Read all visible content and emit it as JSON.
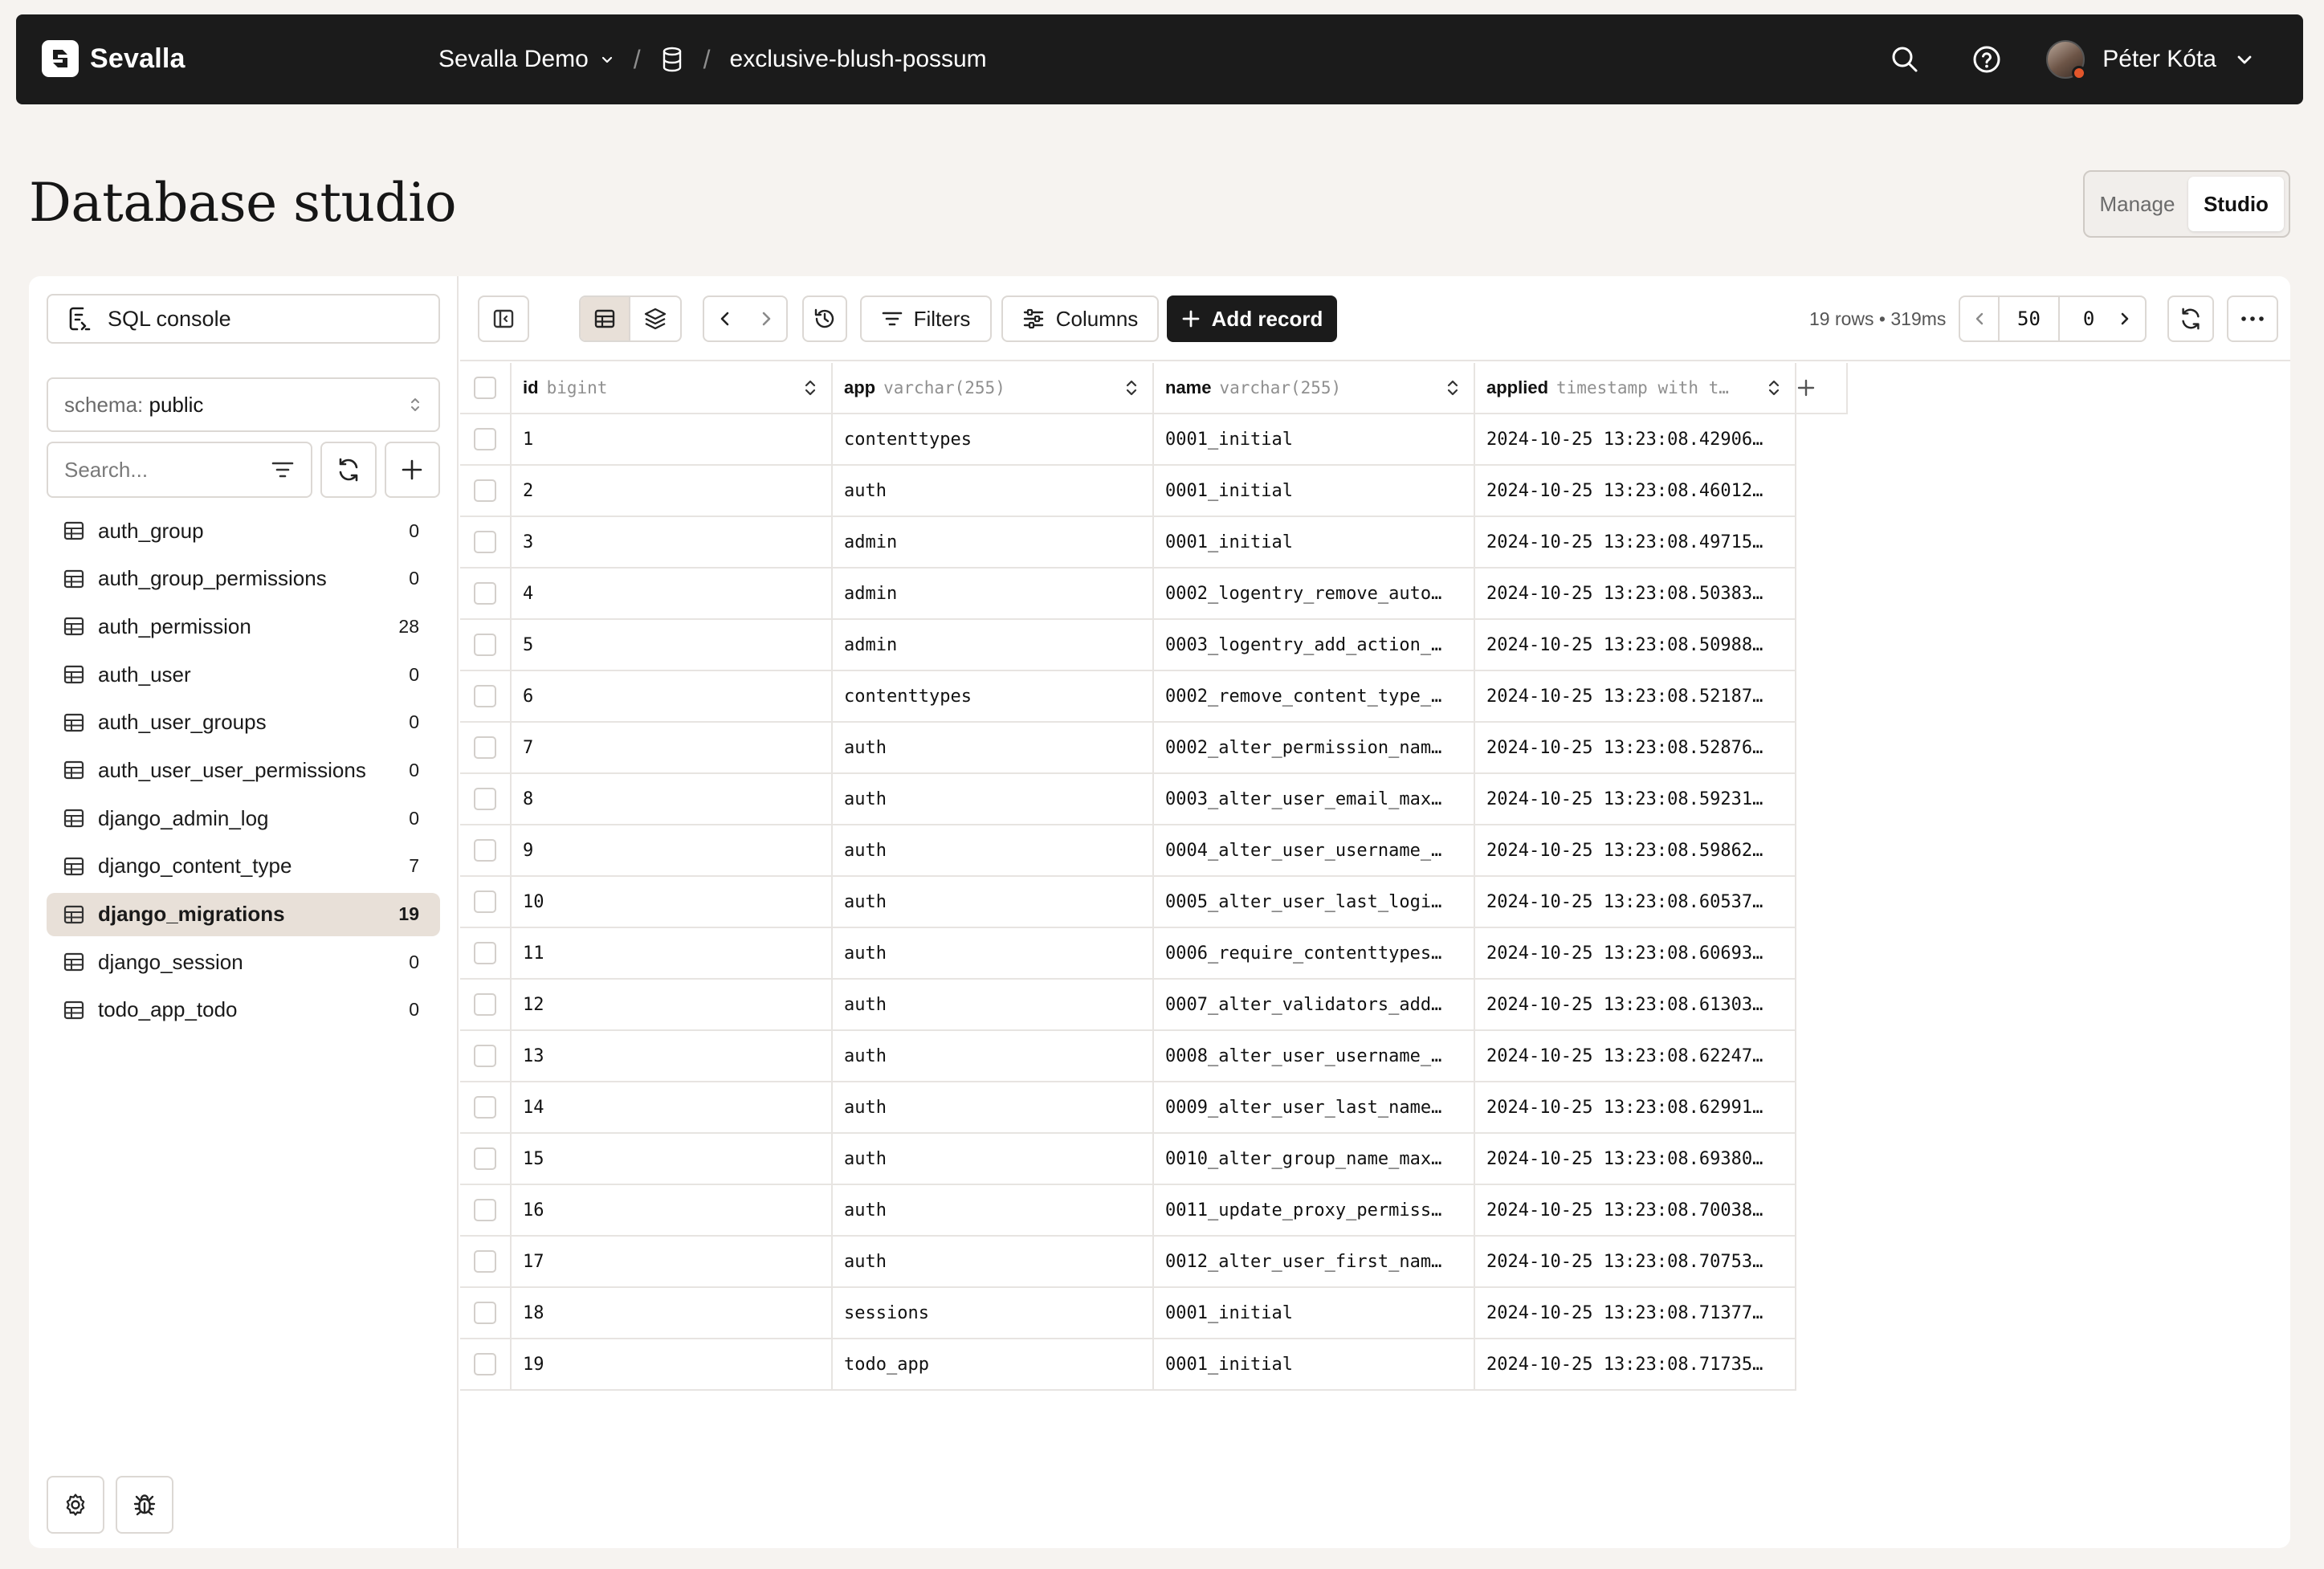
{
  "topbar": {
    "brand": "Sevalla",
    "project": "Sevalla Demo",
    "database": "exclusive-blush-possum",
    "user_name": "Péter Kóta"
  },
  "page": {
    "title": "Database studio",
    "modes": [
      "Manage",
      "Studio"
    ],
    "active_mode": "Studio"
  },
  "sidebar": {
    "sql_console": "SQL console",
    "schema_label": "schema:",
    "schema_value": "public",
    "search_placeholder": "Search...",
    "tables": [
      {
        "name": "auth_group",
        "count": "0"
      },
      {
        "name": "auth_group_permissions",
        "count": "0"
      },
      {
        "name": "auth_permission",
        "count": "28"
      },
      {
        "name": "auth_user",
        "count": "0"
      },
      {
        "name": "auth_user_groups",
        "count": "0"
      },
      {
        "name": "auth_user_user_permissions",
        "count": "0"
      },
      {
        "name": "django_admin_log",
        "count": "0"
      },
      {
        "name": "django_content_type",
        "count": "7"
      },
      {
        "name": "django_migrations",
        "count": "19",
        "active": true
      },
      {
        "name": "django_session",
        "count": "0"
      },
      {
        "name": "todo_app_todo",
        "count": "0"
      }
    ]
  },
  "toolbar": {
    "filters": "Filters",
    "columns": "Columns",
    "add_record": "Add record",
    "rows_info": "19 rows • 319ms",
    "limit": "50",
    "offset": "0"
  },
  "grid": {
    "columns": [
      {
        "name": "id",
        "type": "bigint"
      },
      {
        "name": "app",
        "type": "varchar(255)"
      },
      {
        "name": "name",
        "type": "varchar(255)"
      },
      {
        "name": "applied",
        "type": "timestamp with t…"
      }
    ],
    "rows": [
      [
        "1",
        "contenttypes",
        "0001_initial",
        "2024-10-25 13:23:08.42906…"
      ],
      [
        "2",
        "auth",
        "0001_initial",
        "2024-10-25 13:23:08.46012…"
      ],
      [
        "3",
        "admin",
        "0001_initial",
        "2024-10-25 13:23:08.49715…"
      ],
      [
        "4",
        "admin",
        "0002_logentry_remove_auto…",
        "2024-10-25 13:23:08.50383…"
      ],
      [
        "5",
        "admin",
        "0003_logentry_add_action_…",
        "2024-10-25 13:23:08.50988…"
      ],
      [
        "6",
        "contenttypes",
        "0002_remove_content_type_…",
        "2024-10-25 13:23:08.52187…"
      ],
      [
        "7",
        "auth",
        "0002_alter_permission_nam…",
        "2024-10-25 13:23:08.52876…"
      ],
      [
        "8",
        "auth",
        "0003_alter_user_email_max…",
        "2024-10-25 13:23:08.59231…"
      ],
      [
        "9",
        "auth",
        "0004_alter_user_username_…",
        "2024-10-25 13:23:08.59862…"
      ],
      [
        "10",
        "auth",
        "0005_alter_user_last_logi…",
        "2024-10-25 13:23:08.60537…"
      ],
      [
        "11",
        "auth",
        "0006_require_contenttypes…",
        "2024-10-25 13:23:08.60693…"
      ],
      [
        "12",
        "auth",
        "0007_alter_validators_add…",
        "2024-10-25 13:23:08.61303…"
      ],
      [
        "13",
        "auth",
        "0008_alter_user_username_…",
        "2024-10-25 13:23:08.62247…"
      ],
      [
        "14",
        "auth",
        "0009_alter_user_last_name…",
        "2024-10-25 13:23:08.62991…"
      ],
      [
        "15",
        "auth",
        "0010_alter_group_name_max…",
        "2024-10-25 13:23:08.69380…"
      ],
      [
        "16",
        "auth",
        "0011_update_proxy_permiss…",
        "2024-10-25 13:23:08.70038…"
      ],
      [
        "17",
        "auth",
        "0012_alter_user_first_nam…",
        "2024-10-25 13:23:08.70753…"
      ],
      [
        "18",
        "sessions",
        "0001_initial",
        "2024-10-25 13:23:08.71377…"
      ],
      [
        "19",
        "todo_app",
        "0001_initial",
        "2024-10-25 13:23:08.71735…"
      ]
    ]
  },
  "icons": {
    "brand": "sevalla-logo-icon",
    "database": "database-icon",
    "search": "search-icon",
    "help": "help-circle-icon",
    "table": "table-icon",
    "settings": "gear-icon",
    "debug": "bug-icon"
  },
  "colors": {
    "topbar": "#1b1b1b",
    "page_bg": "#f6f3f0",
    "active_item": "#e8e0d8",
    "primary_button": "#1b1b1b",
    "status_dot": "#e2562b"
  }
}
